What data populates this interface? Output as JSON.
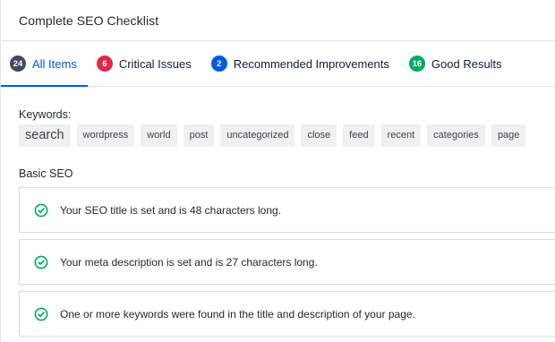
{
  "panel": {
    "title": "Complete SEO Checklist"
  },
  "tabs": [
    {
      "count": "24",
      "label": "All Items"
    },
    {
      "count": "6",
      "label": "Critical Issues"
    },
    {
      "count": "2",
      "label": "Recommended Improvements"
    },
    {
      "count": "16",
      "label": "Good Results"
    }
  ],
  "keywords": {
    "label": "Keywords:",
    "tags": [
      "search",
      "wordpress",
      "world",
      "post",
      "uncategorized",
      "close",
      "feed",
      "recent",
      "categories",
      "page"
    ]
  },
  "basic_seo": {
    "label": "Basic SEO",
    "items": [
      {
        "text": "Your SEO title is set and is 48 characters long.",
        "status": "good"
      },
      {
        "text": "Your meta description is set and is 27 characters long.",
        "status": "good"
      },
      {
        "text": "One or more keywords were found in the title and description of your page.",
        "status": "good"
      }
    ]
  },
  "colors": {
    "accent": "#005ae0",
    "critical": "#df2a4a",
    "good": "#00aa63",
    "neutral": "#434960"
  }
}
